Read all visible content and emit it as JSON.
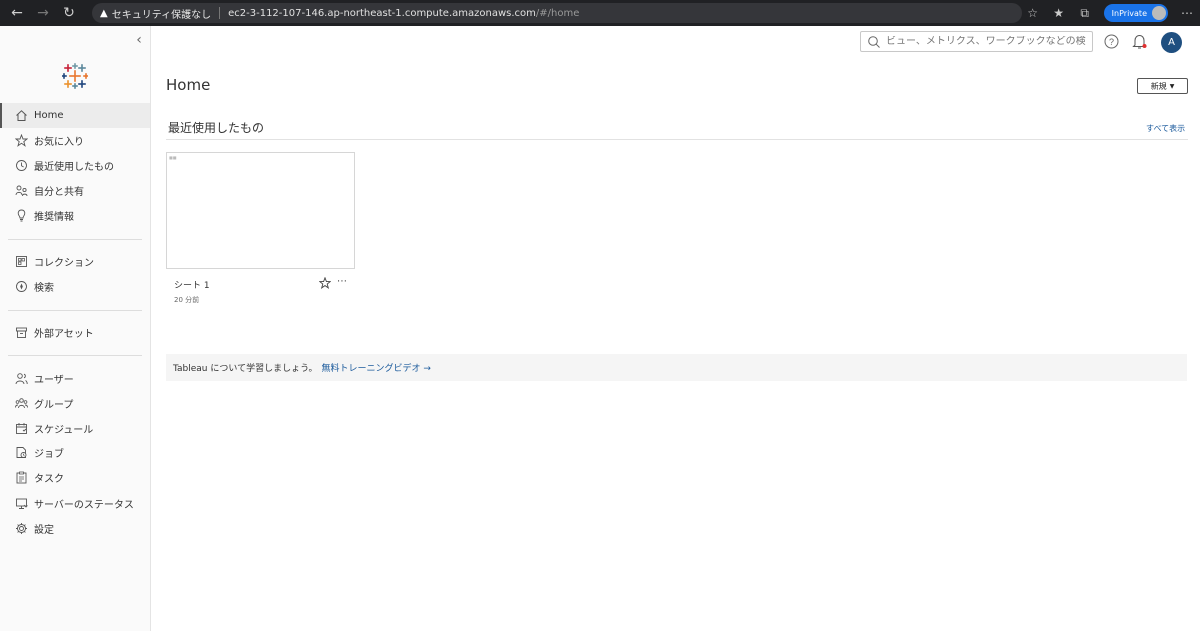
{
  "browser": {
    "security_label": "セキュリティ保護なし",
    "url_host": "ec2-3-112-107-146.ap-northeast-1.compute.amazonaws.com",
    "url_path": "/#/home",
    "inprivate_label": "InPrivate"
  },
  "sidebar": {
    "items": [
      {
        "label": "Home",
        "icon": "home-icon"
      },
      {
        "label": "お気に入り",
        "icon": "star-icon"
      },
      {
        "label": "最近使用したもの",
        "icon": "clock-icon"
      },
      {
        "label": "自分と共有",
        "icon": "shared-users-icon"
      },
      {
        "label": "推奨情報",
        "icon": "lightbulb-icon"
      },
      {
        "label": "コレクション",
        "icon": "collection-icon"
      },
      {
        "label": "検索",
        "icon": "compass-icon"
      },
      {
        "label": "外部アセット",
        "icon": "archive-icon"
      },
      {
        "label": "ユーザー",
        "icon": "users-icon"
      },
      {
        "label": "グループ",
        "icon": "groups-icon"
      },
      {
        "label": "スケジュール",
        "icon": "calendar-icon"
      },
      {
        "label": "ジョブ",
        "icon": "job-icon"
      },
      {
        "label": "タスク",
        "icon": "clipboard-icon"
      },
      {
        "label": "サーバーのステータス",
        "icon": "server-status-icon"
      },
      {
        "label": "設定",
        "icon": "gear-icon"
      }
    ]
  },
  "header": {
    "search_placeholder": "ビュー、メトリクス、ワークブックなどの検索",
    "avatar_initial": "A"
  },
  "main": {
    "title": "Home",
    "new_button": "新規",
    "recent_section": "最近使用したもの",
    "show_all": "すべて表示",
    "recent_items": [
      {
        "name": "シート 1",
        "time": "20 分前"
      }
    ],
    "banner_text": "Tableau について学習しましょう。",
    "banner_link": "無料トレーニングビデオ →"
  },
  "colors": {
    "accent": "#1b5a9c",
    "avatar_bg": "#1f4f80",
    "notification_dot": "#e03030",
    "inprivate": "#1a73e8"
  }
}
